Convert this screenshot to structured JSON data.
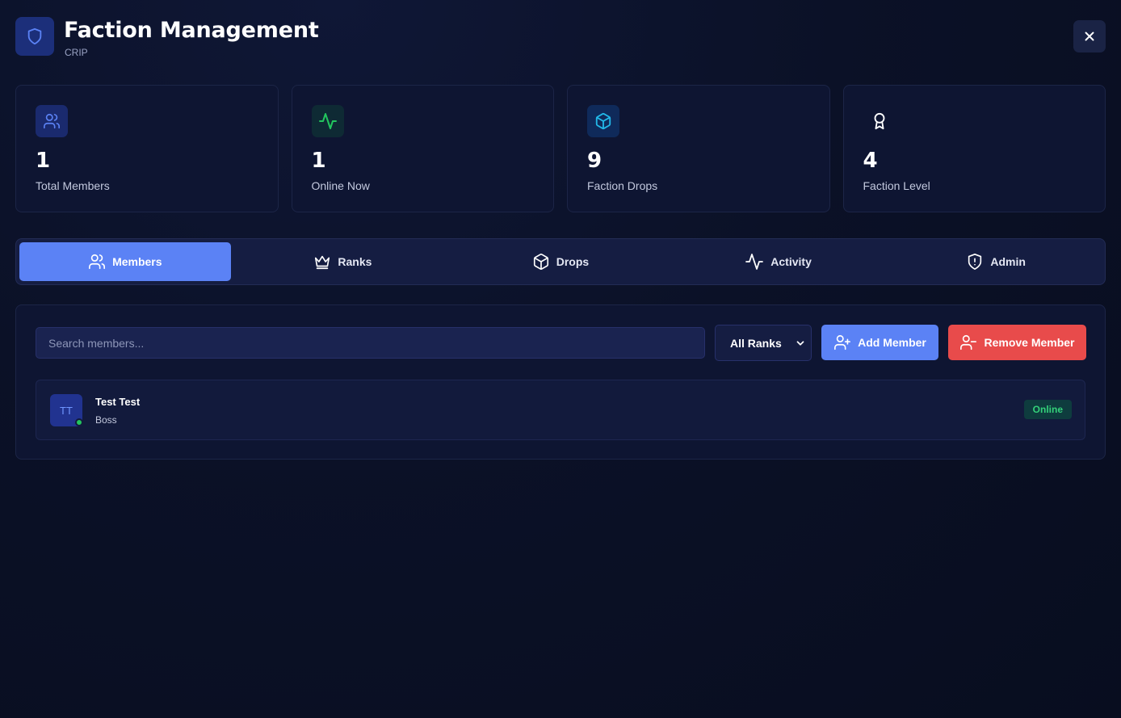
{
  "header": {
    "title": "Faction Management",
    "subtitle": "CRIP",
    "logo_icon": "shield-icon",
    "close_icon": "close-icon"
  },
  "stats": [
    {
      "value": "1",
      "label": "Total Members",
      "icon": "users-icon",
      "color": "#5b82f5"
    },
    {
      "value": "1",
      "label": "Online Now",
      "icon": "activity-icon",
      "color": "#22c55e"
    },
    {
      "value": "9",
      "label": "Faction Drops",
      "icon": "package-icon",
      "color": "#22b8e8"
    },
    {
      "value": "4",
      "label": "Faction Level",
      "icon": "award-icon",
      "color": "#ffffff"
    }
  ],
  "tabs": [
    {
      "label": "Members",
      "icon": "users-icon",
      "active": true
    },
    {
      "label": "Ranks",
      "icon": "crown-icon",
      "active": false
    },
    {
      "label": "Drops",
      "icon": "package-icon",
      "active": false
    },
    {
      "label": "Activity",
      "icon": "activity-icon",
      "active": false
    },
    {
      "label": "Admin",
      "icon": "shield-alert-icon",
      "active": false
    }
  ],
  "members_panel": {
    "search_placeholder": "Search members...",
    "search_value": "",
    "rank_filter": "All Ranks",
    "add_label": "Add Member",
    "remove_label": "Remove Member",
    "members": [
      {
        "initials": "TT",
        "name": "Test Test",
        "rank": "Boss",
        "status": "Online"
      }
    ]
  },
  "colors": {
    "accent": "#5b82f5",
    "danger": "#e84b4b",
    "online": "#22c55e"
  }
}
